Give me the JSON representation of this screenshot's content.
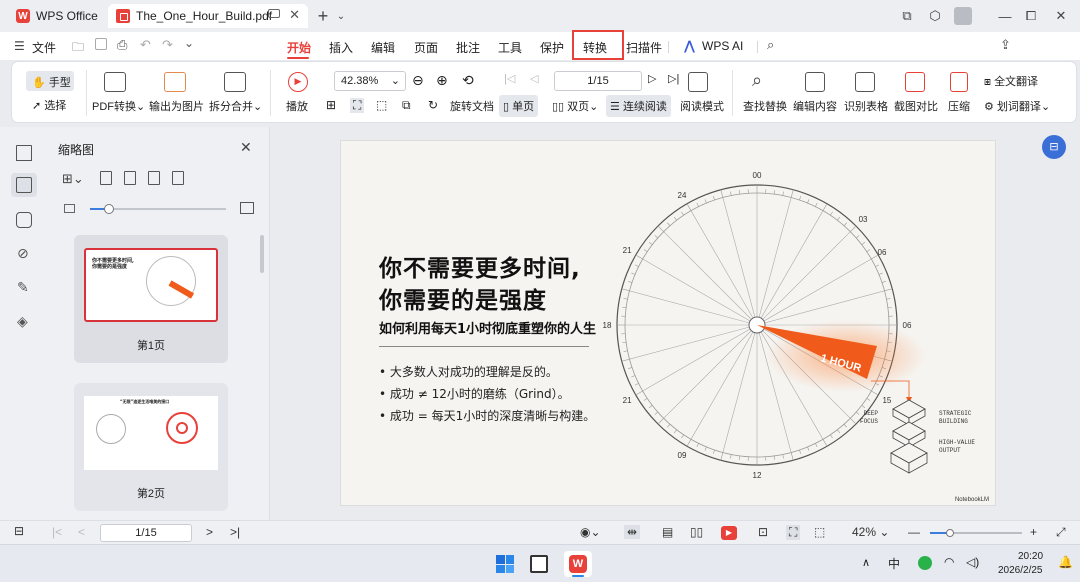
{
  "titlebar": {
    "app_name": "WPS Office",
    "doc_tab": "The_One_Hour_Build.pdf",
    "new_tab_symbol": "+",
    "icons": [
      "screen-icon",
      "close-icon",
      "add-icon",
      "chevron-down-icon",
      "window-restore-icon",
      "cube-icon",
      "avatar",
      "minimize-icon",
      "maximize-icon",
      "close-window-icon"
    ]
  },
  "menubar": {
    "file": "文件",
    "tabs": [
      "开始",
      "插入",
      "编辑",
      "页面",
      "批注",
      "工具",
      "保护",
      "转换",
      "扫描件",
      "WPS AI"
    ],
    "active_tab": "开始",
    "highlighted_tab": "转换",
    "share": "分享"
  },
  "ribbon": {
    "hand": "手型",
    "select": "选择",
    "pdf_convert": "PDF转换",
    "export_image": "输出为图片",
    "split_merge": "拆分合并",
    "play": "播放",
    "zoom_value": "42.38%",
    "rotate": "旋转文档",
    "single_page": "单页",
    "double_page": "双页",
    "continuous": "连续阅读",
    "page_value": "1/15",
    "read_mode": "阅读模式",
    "find_replace": "查找替换",
    "edit_content": "编辑内容",
    "recognize_table": "识别表格",
    "screenshot_compare": "截图对比",
    "compress": "压缩",
    "full_translate": "全文翻译",
    "word_translate": "划词翻译"
  },
  "thumbnails": {
    "title": "缩略图",
    "pages": [
      {
        "label": "第1页",
        "title_line1": "你不需要更多时间,",
        "title_line2": "你需要的是强度"
      },
      {
        "label": "第2页",
        "title_line1": "“无限”追逐生活唯美的接口"
      }
    ]
  },
  "slide": {
    "headline_1": "你不需要更多时间,",
    "headline_2": "你需要的是强度",
    "subtitle": "如何利用每天1小时彻底重塑你的人生",
    "bullets": [
      "大多数人对成功的理解是反的。",
      "成功 ≠ 12小时的磨练（Grind）。",
      "成功 = 每天1小时的深度清晰与构建。"
    ],
    "clock_labels": [
      "00",
      "03",
      "06",
      "06",
      "15",
      "12",
      "09",
      "18",
      "21",
      "21",
      "24"
    ],
    "highlight_label": "1 HOUR",
    "deep_focus": "DEEP\nFOCUS",
    "deep_focus_1": "DEEP",
    "deep_focus_2": "FOCUS",
    "strategic_1": "STRATEGIC",
    "strategic_2": "BUILDING",
    "high_value_1": "HIGH-VALUE",
    "high_value_2": "OUTPUT",
    "brand": "NotebookLM",
    "accent_color": "#f05a1a"
  },
  "statusbar": {
    "page": "1/15",
    "zoom": "42%"
  },
  "taskbar": {
    "ime": "中",
    "time": "20:20",
    "date": "2026/2/25"
  }
}
